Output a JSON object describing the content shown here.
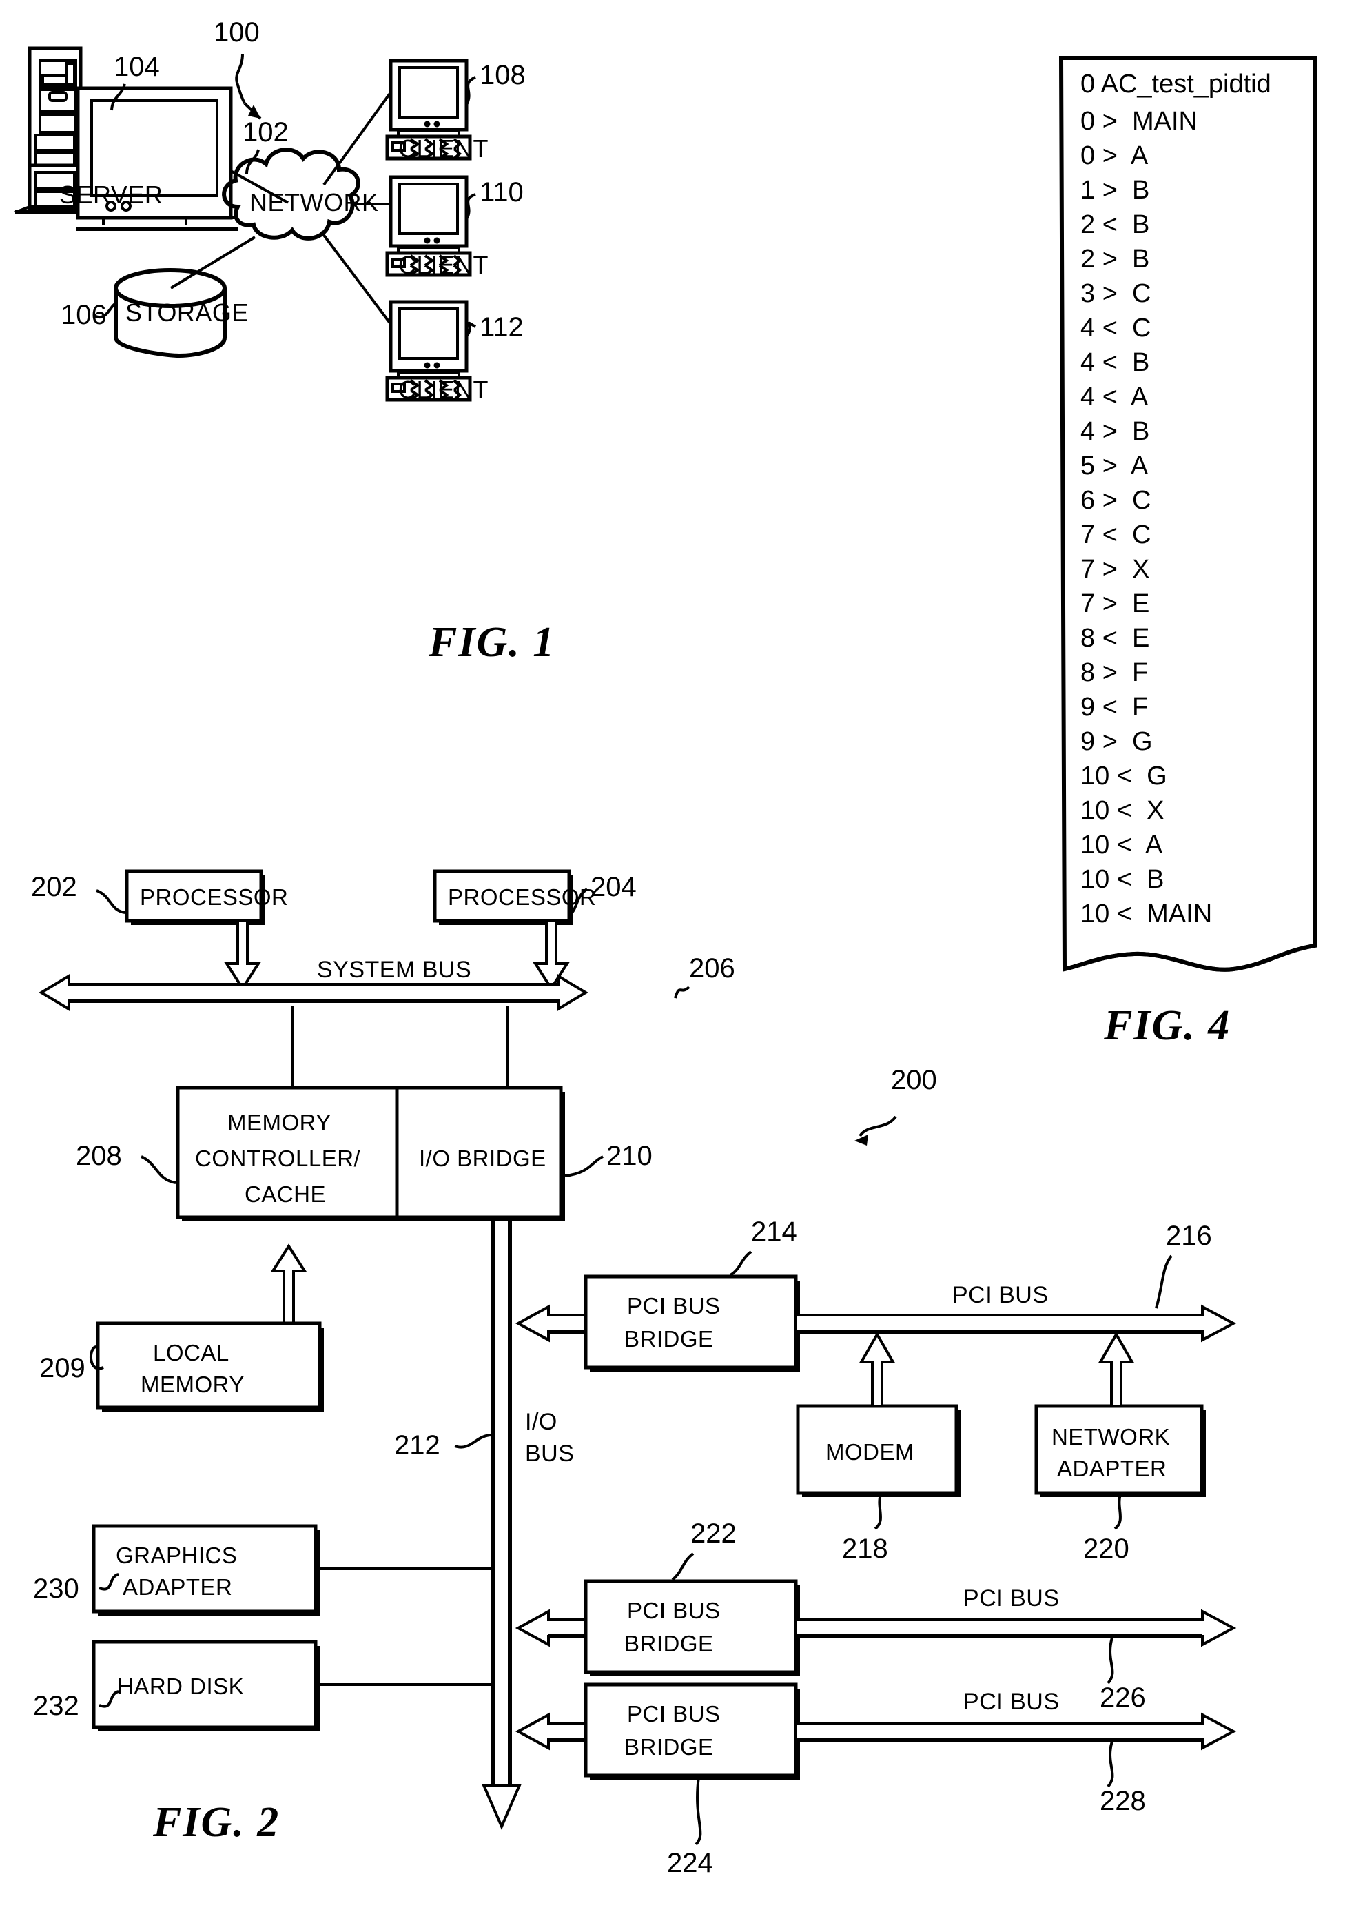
{
  "figures": {
    "fig1": {
      "caption": "FIG. 1",
      "ref_system": "100",
      "nodes": {
        "server": {
          "label": "SERVER",
          "ref": "104"
        },
        "network": {
          "label": "NETWORK",
          "ref": "102"
        },
        "storage": {
          "label": "STORAGE",
          "ref": "106"
        },
        "client1": {
          "label": "CLIENT",
          "ref": "108"
        },
        "client2": {
          "label": "CLIENT",
          "ref": "110"
        },
        "client3": {
          "label": "CLIENT",
          "ref": "112"
        }
      }
    },
    "fig2": {
      "caption": "FIG. 2",
      "ref_system": "200",
      "blocks": {
        "processor1": {
          "label": "PROCESSOR",
          "ref": "202"
        },
        "processor2": {
          "label": "PROCESSOR",
          "ref": "204"
        },
        "system_bus": {
          "label": "SYSTEM BUS",
          "ref": "206"
        },
        "memory_controller": {
          "line1": "MEMORY",
          "line2": "CONTROLLER/",
          "line3": "CACHE",
          "ref": "208"
        },
        "local_memory": {
          "line1": "LOCAL",
          "line2": "MEMORY",
          "ref": "209"
        },
        "io_bridge": {
          "label": "I/O BRIDGE",
          "ref": "210"
        },
        "io_bus": {
          "line1": "I/O",
          "line2": "BUS",
          "ref": "212"
        },
        "pci_bridge_1": {
          "line1": "PCI BUS",
          "line2": "BRIDGE",
          "ref": "214"
        },
        "pci_bus_1": {
          "label": "PCI BUS",
          "ref": "216"
        },
        "modem": {
          "label": "MODEM",
          "ref": "218"
        },
        "network_adapter": {
          "line1": "NETWORK",
          "line2": "ADAPTER",
          "ref": "220"
        },
        "pci_bridge_2": {
          "line1": "PCI BUS",
          "line2": "BRIDGE",
          "ref": "222"
        },
        "pci_bus_2": {
          "label": "PCI BUS",
          "ref": "226"
        },
        "pci_bridge_3": {
          "line1": "PCI BUS",
          "line2": "BRIDGE",
          "ref": "224"
        },
        "pci_bus_3": {
          "label": "PCI BUS",
          "ref": "228"
        },
        "graphics_adapter": {
          "line1": "GRAPHICS",
          "line2": "ADAPTER",
          "ref": "230"
        },
        "hard_disk": {
          "label": "HARD DISK",
          "ref": "232"
        }
      }
    },
    "fig4": {
      "caption": "FIG. 4",
      "title_line": "0 AC_test_pidtid",
      "trace": [
        "0 >  MAIN",
        "0 >  A",
        "1 >  B",
        "2 <  B",
        "2 >  B",
        "3 >  C",
        "4 <  C",
        "4 <  B",
        "4 <  A",
        "4 >  B",
        "5 >  A",
        "6 >  C",
        "7 <  C",
        "7 >  X",
        "7 >  E",
        "8 <  E",
        "8 >  F",
        "9 <  F",
        "9 >  G",
        "10 <  G",
        "10 <  X",
        "10 <  A",
        "10 <  B",
        "10 <  MAIN"
      ]
    }
  }
}
